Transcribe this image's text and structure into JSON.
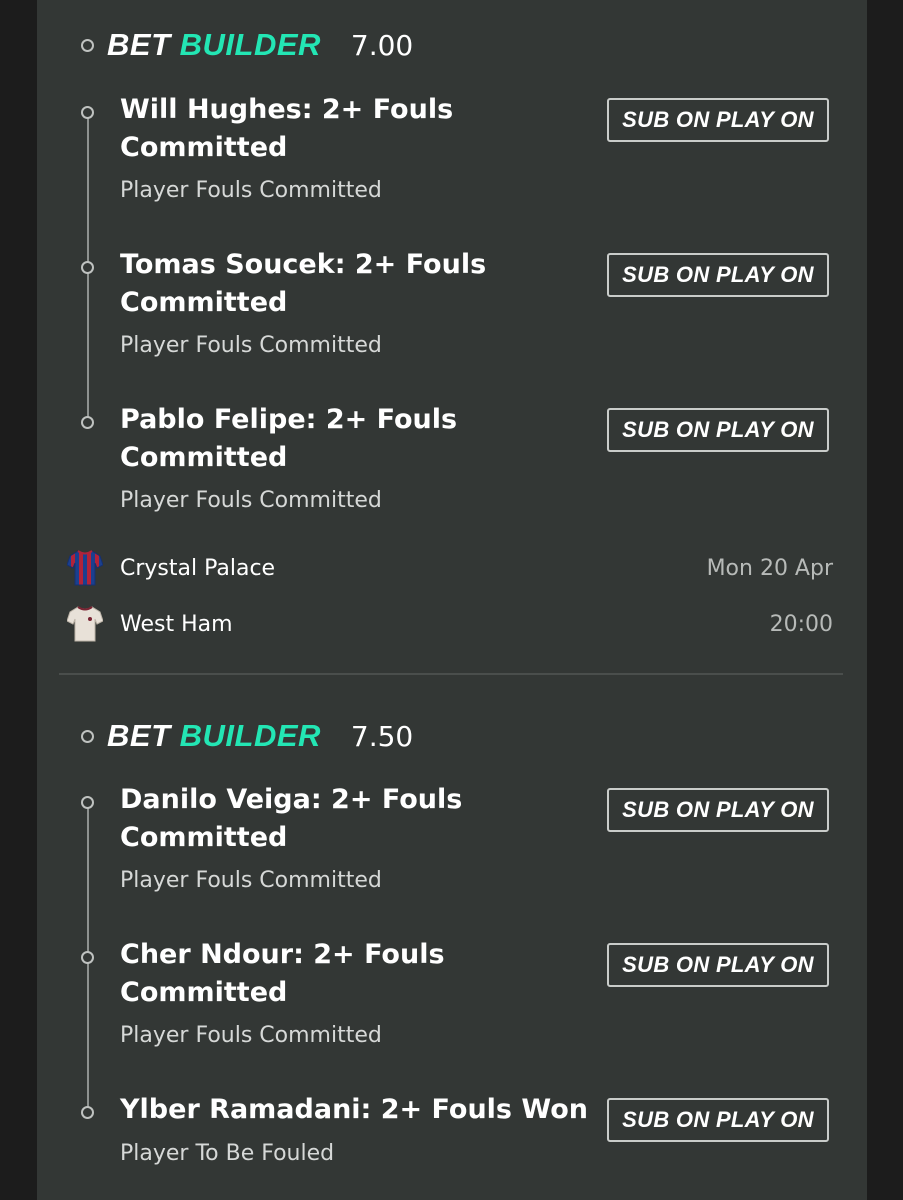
{
  "groups": [
    {
      "title_bet": "BET",
      "title_builder": "BUILDER",
      "odds": "7.00",
      "selections": [
        {
          "title": "Will Hughes: 2+ Fouls Committed",
          "market": "Player Fouls Committed",
          "button": "SUB ON PLAY ON"
        },
        {
          "title": "Tomas Soucek: 2+ Fouls Committed",
          "market": "Player Fouls Committed",
          "button": "SUB ON PLAY ON"
        },
        {
          "title": "Pablo Felipe: 2+ Fouls Committed",
          "market": "Player Fouls Committed",
          "button": "SUB ON PLAY ON"
        }
      ],
      "match": {
        "home": {
          "name": "Crystal Palace",
          "meta": "Mon 20 Apr",
          "icon": "crystal-palace-shirt-icon"
        },
        "away": {
          "name": "West Ham",
          "meta": "20:00",
          "icon": "west-ham-shirt-icon"
        }
      }
    },
    {
      "title_bet": "BET",
      "title_builder": "BUILDER",
      "odds": "7.50",
      "selections": [
        {
          "title": "Danilo Veiga: 2+ Fouls Committed",
          "market": "Player Fouls Committed",
          "button": "SUB ON PLAY ON"
        },
        {
          "title": "Cher Ndour: 2+ Fouls Committed",
          "market": "Player Fouls Committed",
          "button": "SUB ON PLAY ON"
        },
        {
          "title": "Ylber Ramadani: 2+ Fouls Won",
          "market": "Player To Be Fouled",
          "button": "SUB ON PLAY ON"
        }
      ]
    }
  ],
  "colors": {
    "accent": "#23e6b4",
    "panel": "#333735",
    "background": "#1c1c1c"
  }
}
